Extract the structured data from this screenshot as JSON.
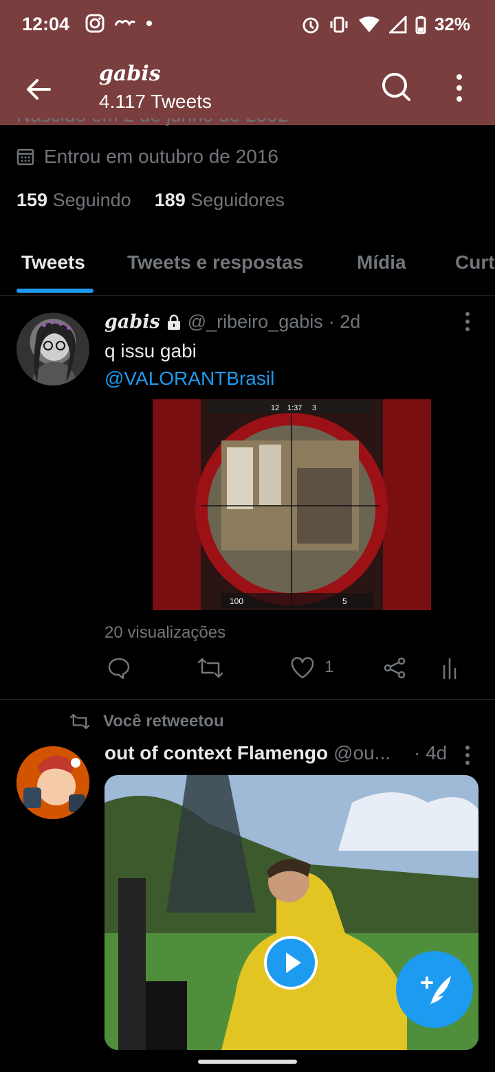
{
  "status_bar": {
    "time": "12:04",
    "battery": "32%"
  },
  "app_bar": {
    "title": "gabis",
    "subtitle": "4.117 Tweets"
  },
  "profile": {
    "partial_line": "Nascido em 2 de junho de 2002",
    "joined": "Entrou em outubro de 2016",
    "following_count": "159",
    "following_label": "Seguindo",
    "followers_count": "189",
    "followers_label": "Seguidores"
  },
  "tabs": [
    "Tweets",
    "Tweets e respostas",
    "Mídia",
    "Curt"
  ],
  "tweet1": {
    "name": "gabis",
    "handle": "@_ribeiro_gabis",
    "time": "· 2d",
    "text": "q issu gabi",
    "mention": "@VALORANTBrasil",
    "views": "20 visualizações",
    "likes": "1",
    "media_hud": {
      "score_left": "12",
      "timer": "1:37",
      "score_right": "3",
      "health": "100",
      "ammo": "5"
    }
  },
  "retweet_label": "Você retweetou",
  "tweet2": {
    "name": "out of context Flamengo",
    "handle": "@ou...",
    "time": "· 4d"
  },
  "colors": {
    "accent": "#1d9bf0",
    "header": "#7a3e3e",
    "background": "#000000",
    "muted": "#71767b"
  },
  "icons": [
    "back-arrow-icon",
    "search-icon",
    "more-vertical-icon",
    "calendar-icon",
    "lock-icon",
    "reply-icon",
    "retweet-icon",
    "like-icon",
    "share-icon",
    "views-icon",
    "play-icon",
    "compose-icon"
  ]
}
